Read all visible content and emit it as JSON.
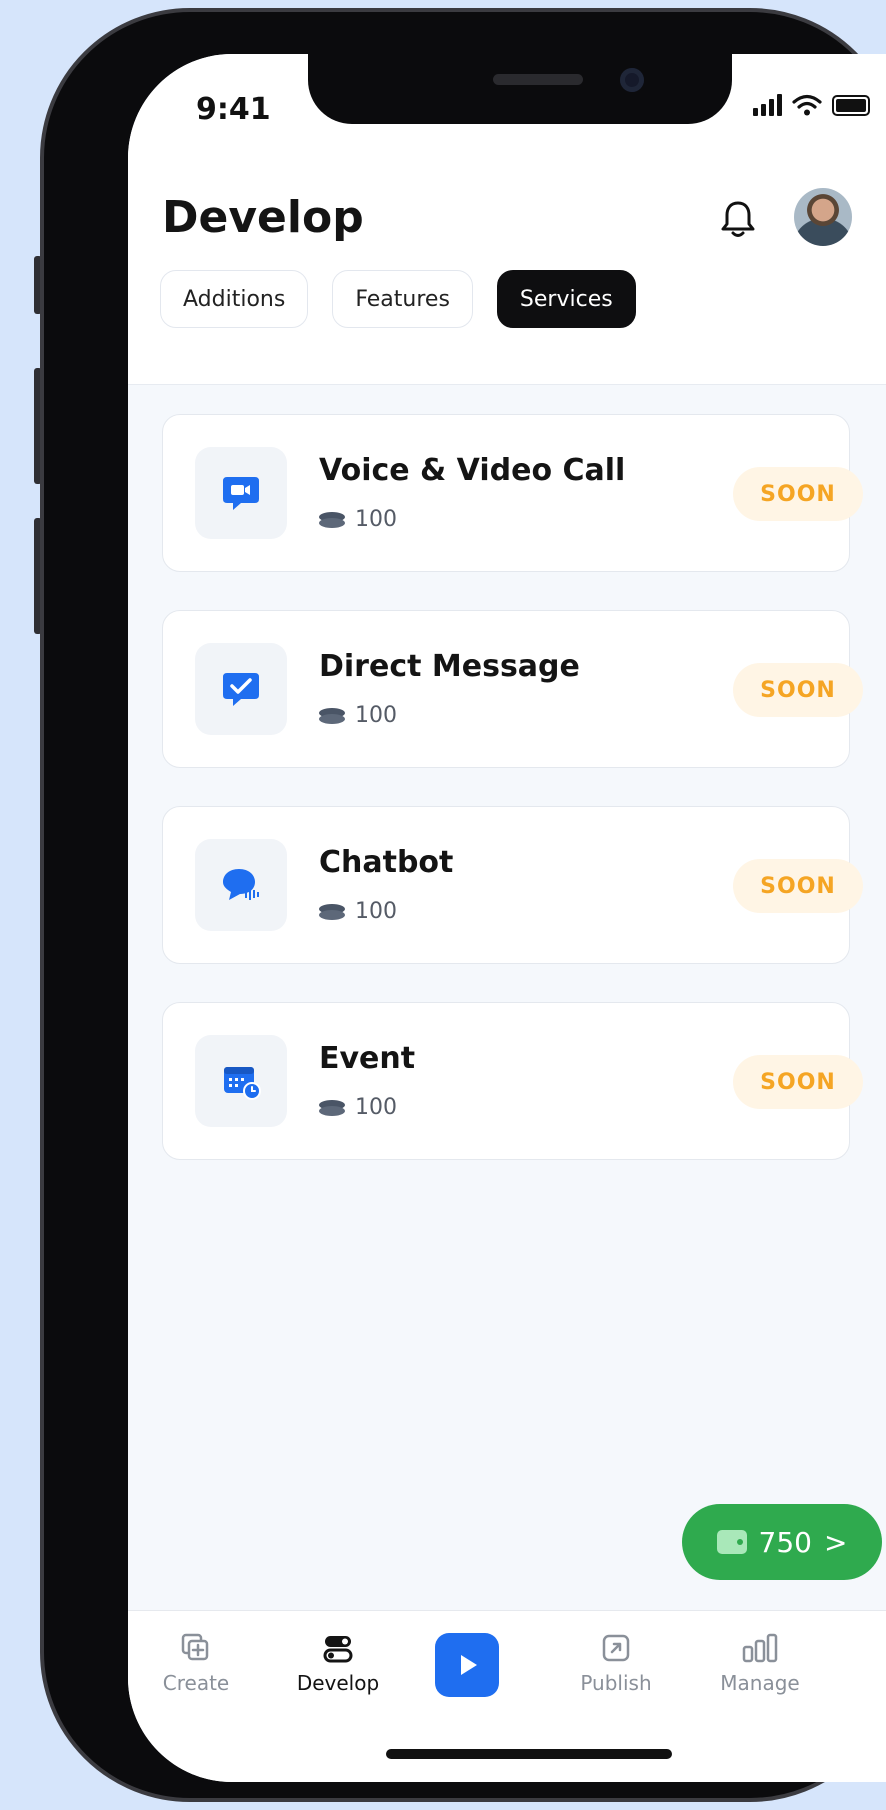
{
  "status": {
    "time": "9:41"
  },
  "header": {
    "title": "Develop",
    "tabs": [
      {
        "label": "Additions",
        "active": false
      },
      {
        "label": "Features",
        "active": false
      },
      {
        "label": "Services",
        "active": true
      }
    ]
  },
  "services": [
    {
      "title": "Voice & Video Call",
      "cost": "100",
      "badge": "SOON",
      "icon": "video-call-icon"
    },
    {
      "title": "Direct Message",
      "cost": "100",
      "badge": "SOON",
      "icon": "direct-message-icon"
    },
    {
      "title": "Chatbot",
      "cost": "100",
      "badge": "SOON",
      "icon": "chatbot-icon"
    },
    {
      "title": "Event",
      "cost": "100",
      "badge": "SOON",
      "icon": "event-calendar-icon"
    }
  ],
  "wallet": {
    "balance": "750",
    "chevron": ">"
  },
  "nav": {
    "create": "Create",
    "develop": "Develop",
    "publish": "Publish",
    "manage": "Manage"
  },
  "colors": {
    "accent_blue": "#1f6ef0",
    "wallet_green": "#2faa4e",
    "soon_text": "#f5a524",
    "soon_bg": "#fff5e5",
    "page_bg": "#d6e5fb"
  }
}
